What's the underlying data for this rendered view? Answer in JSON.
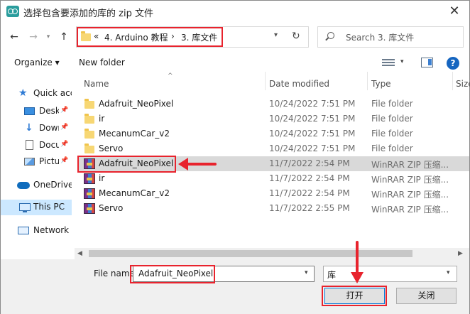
{
  "window": {
    "title": "选择包含要添加的库的 zip 文件",
    "close_glyph": "✕"
  },
  "address": {
    "overflow_glyph": "«",
    "crumbs": [
      "4. Arduino 教程",
      "3. 库文件"
    ],
    "separator": "›",
    "search_placeholder": "Search 3. 库文件"
  },
  "toolbar": {
    "organize_label": "Organize ▾",
    "new_folder_label": "New folder",
    "help_glyph": "?"
  },
  "sidebar": {
    "items": [
      {
        "label": "Quick access",
        "icon": "star-icon"
      },
      {
        "label": "Desktop",
        "icon": "desktop-icon"
      },
      {
        "label": "Downloads",
        "icon": "downloads-icon"
      },
      {
        "label": "Documents",
        "icon": "documents-icon"
      },
      {
        "label": "Pictures",
        "icon": "pictures-icon"
      },
      {
        "label": "OneDrive",
        "icon": "cloud-icon"
      },
      {
        "label": "This PC",
        "icon": "computer-icon"
      },
      {
        "label": "Network",
        "icon": "network-icon"
      }
    ]
  },
  "columns": {
    "name": "Name",
    "date": "Date modified",
    "type": "Type",
    "size": "Size"
  },
  "files": [
    {
      "name": "Adafruit_NeoPixel",
      "date": "10/24/2022 7:51 PM",
      "type": "File folder",
      "kind": "folder"
    },
    {
      "name": "ir",
      "date": "10/24/2022 7:51 PM",
      "type": "File folder",
      "kind": "folder"
    },
    {
      "name": "MecanumCar_v2",
      "date": "10/24/2022 7:51 PM",
      "type": "File folder",
      "kind": "folder"
    },
    {
      "name": "Servo",
      "date": "10/24/2022 7:51 PM",
      "type": "File folder",
      "kind": "folder"
    },
    {
      "name": "Adafruit_NeoPixel",
      "date": "11/7/2022 2:54 PM",
      "type": "WinRAR ZIP 压缩...",
      "kind": "zip"
    },
    {
      "name": "ir",
      "date": "11/7/2022 2:54 PM",
      "type": "WinRAR ZIP 压缩...",
      "kind": "zip"
    },
    {
      "name": "MecanumCar_v2",
      "date": "11/7/2022 2:54 PM",
      "type": "WinRAR ZIP 压缩...",
      "kind": "zip"
    },
    {
      "name": "Servo",
      "date": "11/7/2022 2:55 PM",
      "type": "WinRAR ZIP 压缩...",
      "kind": "zip"
    }
  ],
  "bottom": {
    "file_name_label": "File name",
    "file_name_value": "Adafruit_NeoPixel",
    "file_type_value": "库",
    "open_label": "打开",
    "cancel_label": "关闭"
  },
  "colors": {
    "annotation_red": "#e8232d",
    "selection_blue": "#cce8ff",
    "row_selected": "#d9d9d9",
    "folder_yellow": "#f7d774"
  }
}
